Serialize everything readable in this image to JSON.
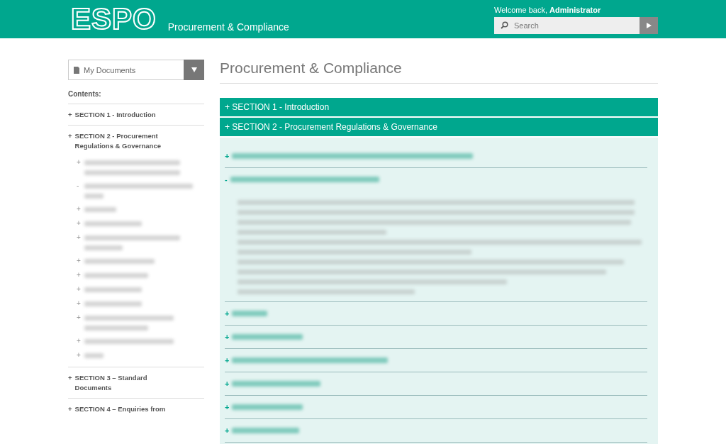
{
  "header": {
    "logo": "ESPO",
    "subtitle": "Procurement & Compliance",
    "welcome": "Welcome back,",
    "user": "Administrator",
    "search": {
      "placeholder": "Search"
    }
  },
  "sidebar": {
    "dropdown": "My Documents",
    "contents_label": "Contents:",
    "sections": [
      {
        "marker": "+",
        "label": "SECTION 1 - Introduction"
      },
      {
        "marker": "+",
        "label": "SECTION 2 - Procurement Regulations & Governance",
        "children": [
          {
            "marker": "+"
          },
          {
            "marker": "-"
          },
          {
            "marker": "+"
          },
          {
            "marker": "+"
          },
          {
            "marker": "+"
          },
          {
            "marker": "+"
          },
          {
            "marker": "+"
          },
          {
            "marker": "+"
          },
          {
            "marker": "+"
          },
          {
            "marker": "+"
          },
          {
            "marker": "+"
          },
          {
            "marker": "+"
          }
        ]
      },
      {
        "marker": "+",
        "label": "SECTION 3 – Standard Documents"
      },
      {
        "marker": "+",
        "label": "SECTION 4 – Enquiries from"
      }
    ]
  },
  "main": {
    "title": "Procurement & Compliance",
    "sections": [
      {
        "label": "+ SECTION 1 - Introduction"
      },
      {
        "label": "+ SECTION 2 - Procurement Regulations & Governance"
      }
    ],
    "items": [
      {
        "marker": "+",
        "expanded": false
      },
      {
        "marker": "-",
        "expanded": true
      },
      {
        "marker": "+",
        "expanded": false
      },
      {
        "marker": "+",
        "expanded": false
      },
      {
        "marker": "+",
        "expanded": false
      },
      {
        "marker": "+",
        "expanded": false
      },
      {
        "marker": "+",
        "expanded": false
      },
      {
        "marker": "+",
        "expanded": false
      }
    ]
  }
}
